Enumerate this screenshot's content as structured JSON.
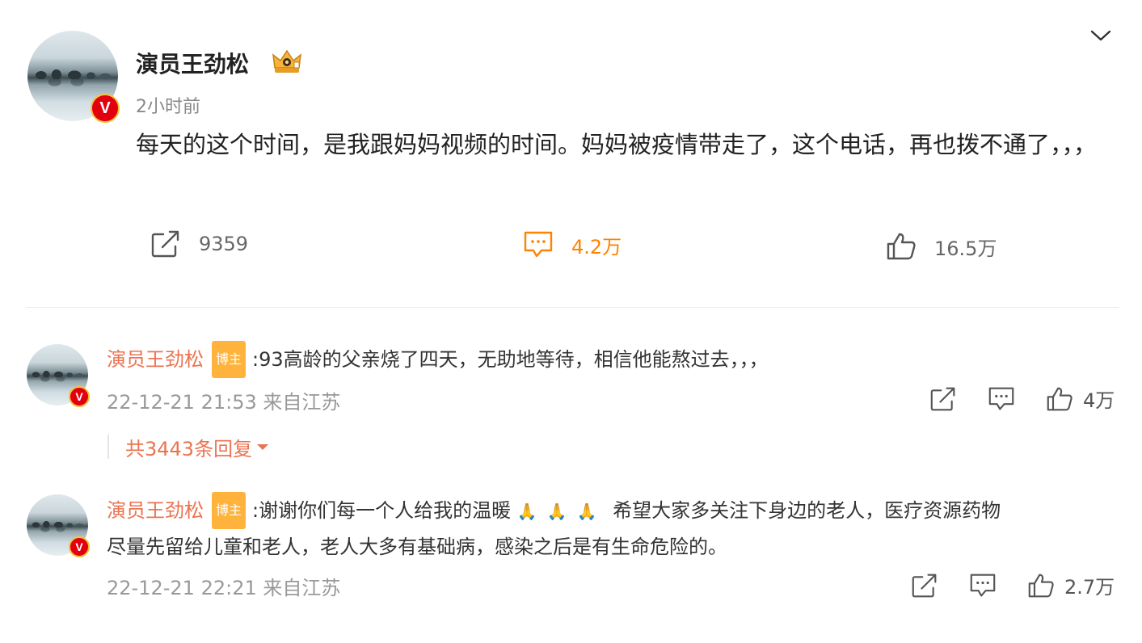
{
  "post": {
    "author": "演员王劲松",
    "time": "2小时前",
    "text": "每天的这个时间，是我跟妈妈视频的时间。妈妈被疫情带走了，这个电话，再也拨不通了，，，",
    "actions": {
      "repost_count": "9359",
      "comment_count": "4.2万",
      "like_count": "16.5万"
    },
    "colors": {
      "active": "#ff8200",
      "name": "#eb7350",
      "tag": "#ffb33c"
    }
  },
  "comments": [
    {
      "name": "演员王劲松",
      "tag": "博主",
      "text": ":93高龄的父亲烧了四天，无助地等待，相信他能熬过去，，，",
      "meta": "22-12-21 21:53 来自江苏",
      "likes": "4万",
      "replies_label": "共3443条回复"
    },
    {
      "name": "演员王劲松",
      "tag": "博主",
      "text_a": ":谢谢你们每一个人给我的温暖",
      "emoji": "🙏🙏🙏",
      "text_b": "希望大家多关注下身边的老人，医疗资源药物",
      "text_line2": "尽量先留给儿童和老人，老人大多有基础病，感染之后是有生命危险的。",
      "meta": "22-12-21 22:21 来自江苏",
      "likes": "2.7万"
    }
  ]
}
